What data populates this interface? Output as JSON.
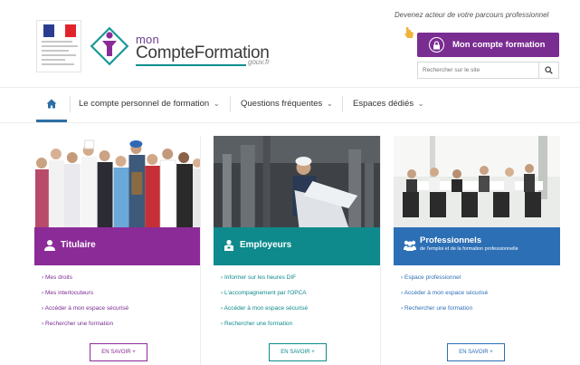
{
  "header": {
    "tagline": "Devenez acteur de votre parcours professionnel",
    "brand": {
      "mon": "mon",
      "name": "CompteFormation",
      "gouv": "gouv.fr"
    },
    "account_button": "Mon compte formation",
    "search": {
      "placeholder": "Rechercher sur le site",
      "value": ""
    }
  },
  "nav": {
    "items": [
      {
        "label": "Le compte personnel de formation",
        "chevron": "⌄"
      },
      {
        "label": "Questions fréquentes",
        "chevron": "⌄"
      },
      {
        "label": "Espaces dédiés",
        "chevron": "⌄"
      }
    ]
  },
  "cards": [
    {
      "title": "Titulaire",
      "color": "#8b2b98",
      "icon": "user-icon",
      "links": [
        "Mes droits",
        "Mes interlocuteurs",
        "Accéder à mon espace sécurisé",
        "Rechercher une formation"
      ],
      "more": "EN SAVOIR +"
    },
    {
      "title": "Employeurs",
      "color": "#0e8a8c",
      "icon": "building-user-icon",
      "links": [
        "Informer sur les heures DIF",
        "L'accompagnement par l'OPCA",
        "Accéder à mon espace sécurisé",
        "Rechercher une formation"
      ],
      "more": "EN SAVOIR +"
    },
    {
      "title": "Professionnels",
      "subtitle": "de l'emploi et de la formation professionnelle",
      "color": "#2d6fb5",
      "icon": "group-icon",
      "links": [
        "Espace professionnel",
        "Accéder à mon espace sécurisé",
        "Rechercher une formation"
      ],
      "more": "EN SAVOIR +"
    }
  ],
  "colors": {
    "accent_purple": "#7a2d91",
    "teal": "#0e8a8c",
    "blue": "#2d6fb5",
    "nav_active": "#2c6fa6"
  }
}
